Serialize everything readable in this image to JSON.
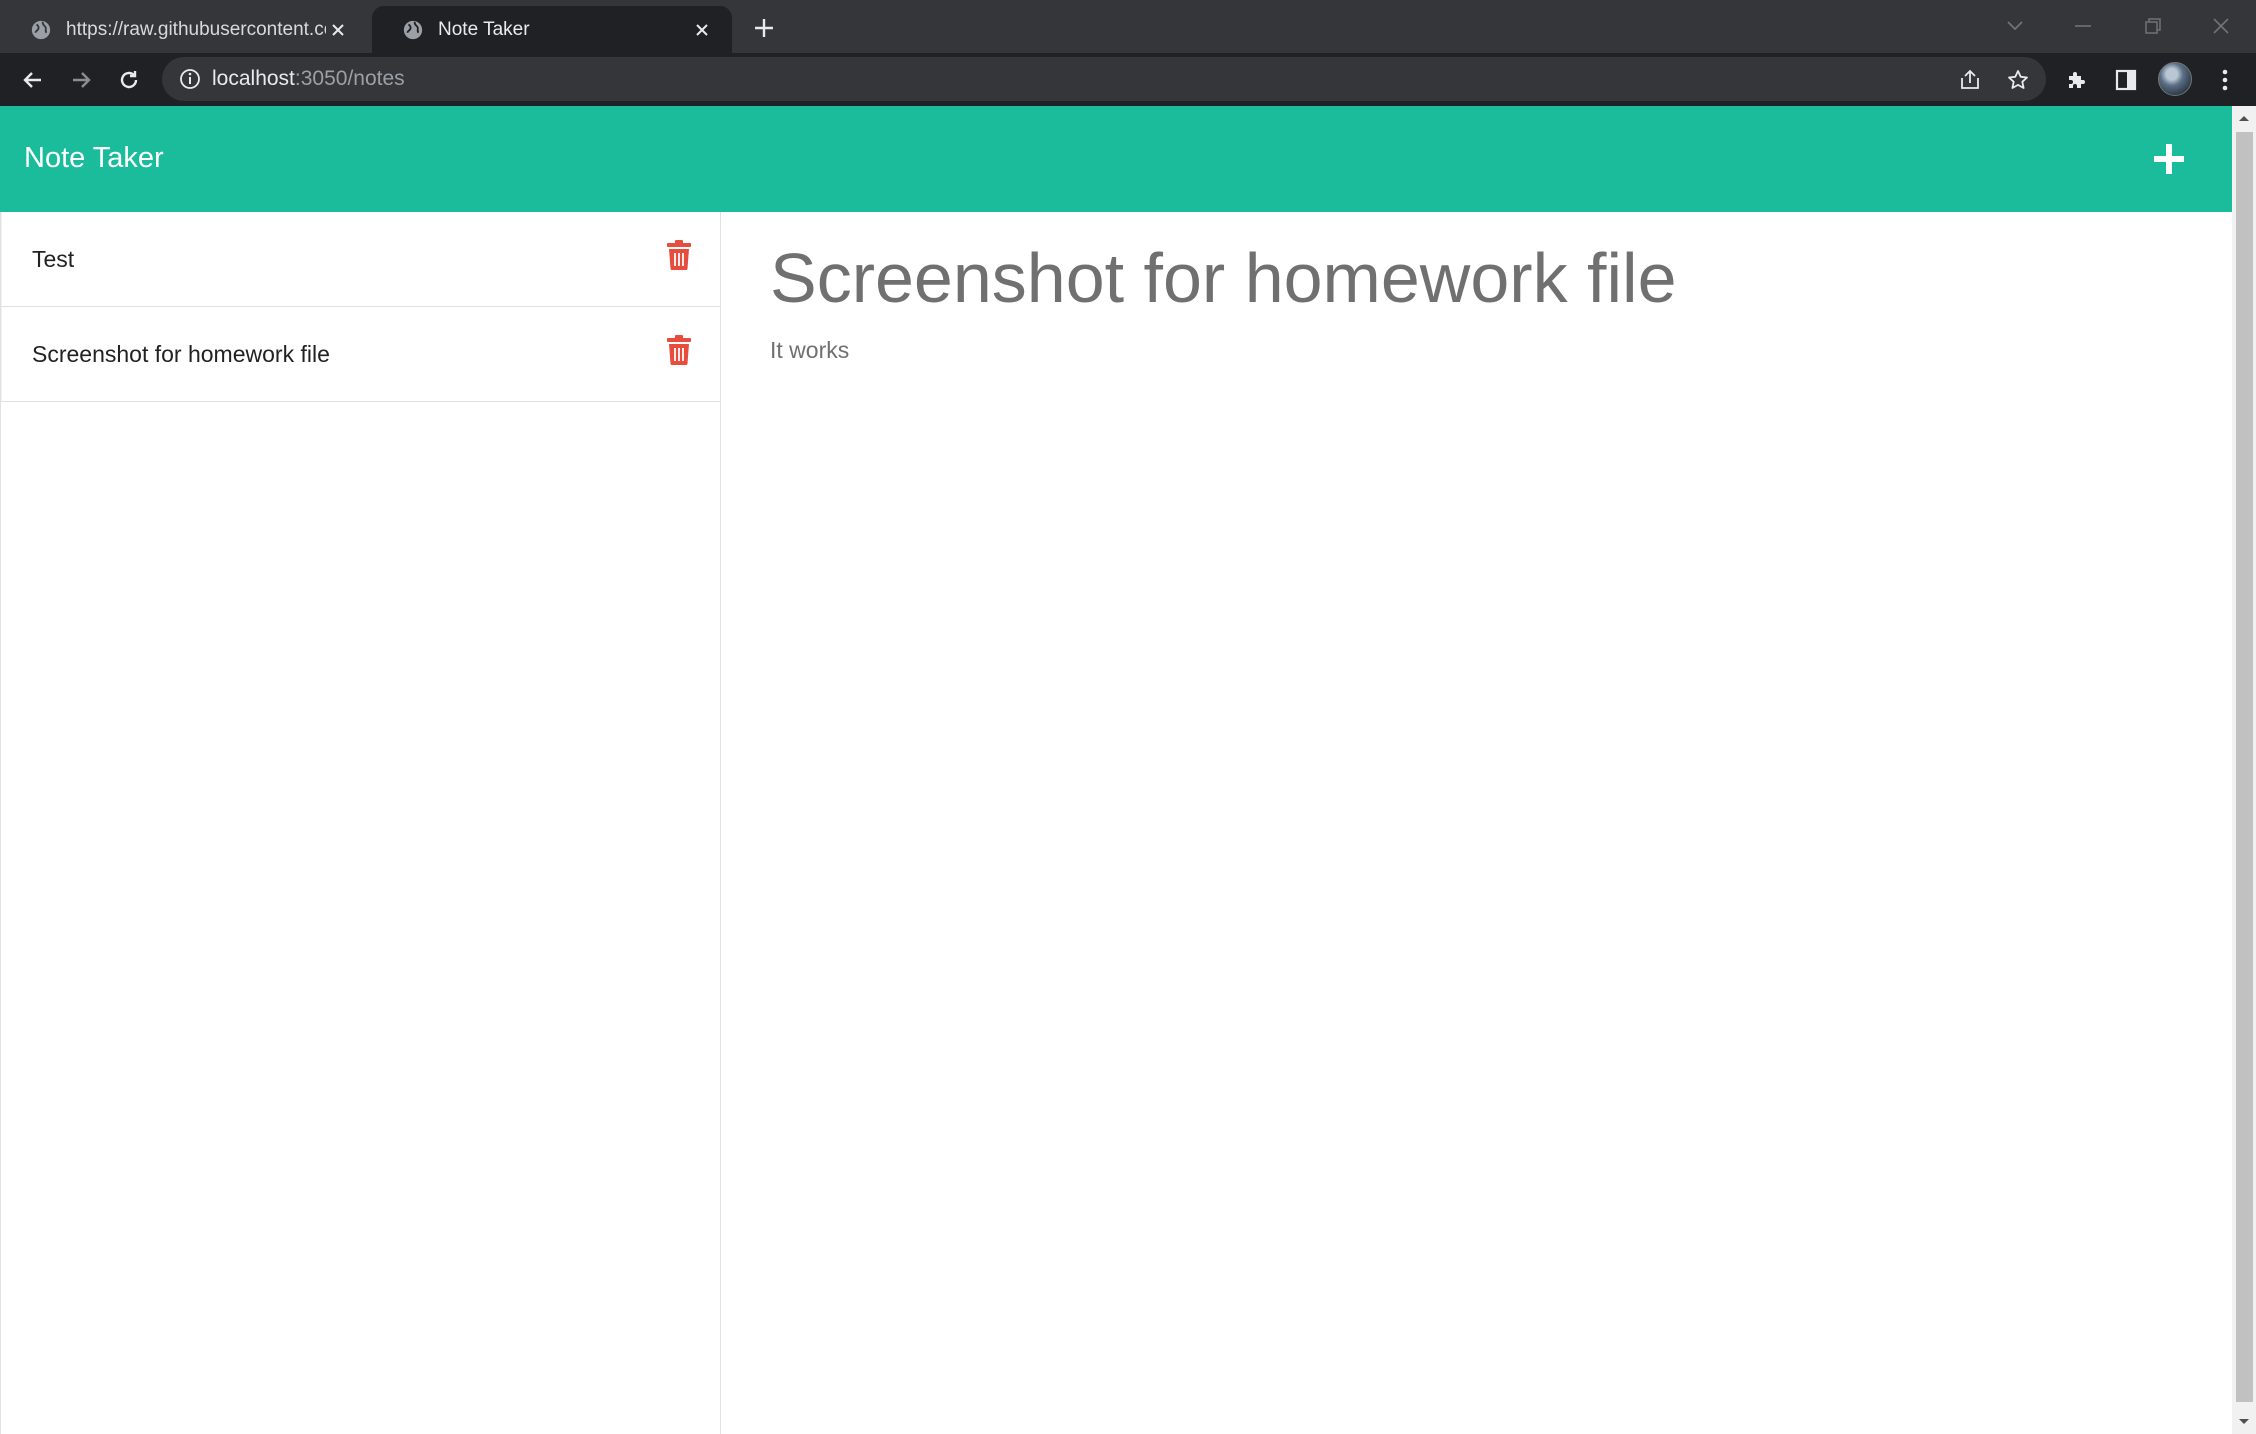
{
  "browser": {
    "tabs": [
      {
        "title": "https://raw.githubusercontent.com",
        "active": false
      },
      {
        "title": "Note Taker",
        "active": true
      }
    ],
    "address": {
      "host": "localhost",
      "rest": ":3050/notes"
    },
    "icons": {
      "back": "back-arrow-icon",
      "forward": "forward-arrow-icon",
      "reload": "reload-icon",
      "info": "info-icon",
      "share": "share-icon",
      "bookmark": "star-icon",
      "extensions": "puzzle-icon",
      "sidepanel": "side-panel-icon",
      "menu": "kebab-menu-icon"
    }
  },
  "app": {
    "brand": "Note Taker",
    "colors": {
      "navbar": "#1abc9c",
      "delete": "#e74c3c"
    },
    "notes": [
      {
        "title": "Test"
      },
      {
        "title": "Screenshot for homework file"
      }
    ],
    "active_note": {
      "title": "Screenshot for homework file",
      "text": "It works"
    }
  }
}
